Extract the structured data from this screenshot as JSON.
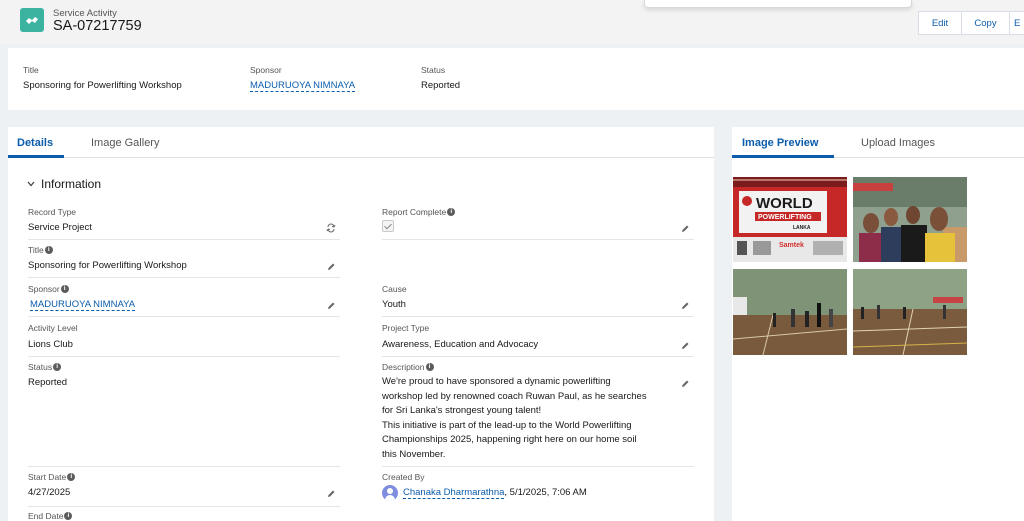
{
  "header": {
    "record_type": "Service Activity",
    "record_name": "SA-07217759",
    "actions": [
      "Edit",
      "Copy",
      "E"
    ]
  },
  "highlights": [
    {
      "label": "Title",
      "value": "Sponsoring for Powerlifting Workshop"
    },
    {
      "label": "Sponsor",
      "value": "MADURUOYA NIMNAYA"
    },
    {
      "label": "Status",
      "value": "Reported"
    }
  ],
  "details": {
    "tabs": [
      "Details",
      "Image Gallery"
    ],
    "section_title": "Information",
    "fields": {
      "record_type": {
        "label": "Record Type",
        "value": "Service Project"
      },
      "report_complete": {
        "label": "Report Complete",
        "checked": true
      },
      "title": {
        "label": "Title",
        "value": "Sponsoring for Powerlifting Workshop"
      },
      "sponsor": {
        "label": "Sponsor",
        "value": "MADURUOYA NIMNAYA"
      },
      "cause": {
        "label": "Cause",
        "value": "Youth"
      },
      "activity_level": {
        "label": "Activity Level",
        "value": "Lions Club"
      },
      "project_type": {
        "label": "Project Type",
        "value": "Awareness, Education and Advocacy"
      },
      "status": {
        "label": "Status",
        "value": "Reported"
      },
      "description": {
        "label": "Description",
        "lines": [
          "We're proud to have sponsored a dynamic powerlifting",
          "workshop led by renowned coach Ruwan Paul, as he searches",
          "for Sri Lanka's strongest young talent!",
          "This initiative is part of the lead-up to the World Powerlifting",
          "Championships 2025, happening right here on our home soil",
          "this November."
        ]
      },
      "start_date": {
        "label": "Start Date",
        "value": "4/27/2025"
      },
      "created_by": {
        "label": "Created By",
        "user": "Chanaka Dharmarathna",
        "date": ", 5/1/2025, 7:06 AM"
      },
      "end_date": {
        "label": "End Date"
      }
    }
  },
  "preview": {
    "tabs": [
      "Image Preview",
      "Upload Images"
    ],
    "banner_text": {
      "world": "WORLD",
      "sub": "POWERLIFTING",
      "country": "LANKA",
      "sponsor": "Samtek"
    }
  },
  "colors": {
    "brand": "#0b5cab",
    "icon_bg": "#3bb3a0"
  }
}
